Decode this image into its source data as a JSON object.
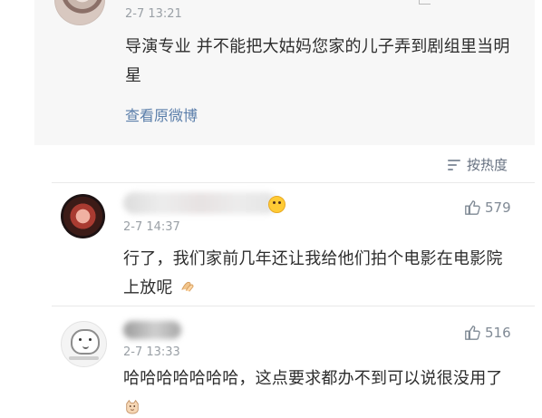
{
  "main_comment": {
    "time": "2-7 13:21",
    "text": "导演专业 并不能把大姑妈您家的儿子弄到剧组里当明星",
    "view_original": "查看原微博"
  },
  "sort": {
    "label": "按热度"
  },
  "comments": [
    {
      "time": "2-7 14:37",
      "likes": "579",
      "text": "行了，我们家前几年还让我给他们拍个电影在电影院上放呢"
    },
    {
      "time": "2-7 13:33",
      "likes": "516",
      "text": "哈哈哈哈哈哈哈，这点要求都办不到可以说很没用了"
    }
  ],
  "icons": {
    "sort": "sort-lines-icon",
    "like": "thumb-up-icon",
    "emoji_1": "surprised-face-icon",
    "emoji_2": "clapping-hands-icon",
    "emoji_3": "cat-face-icon"
  },
  "colors": {
    "link": "#5a7eaa",
    "muted": "#9aa0a6",
    "text": "#2d2d2d"
  }
}
